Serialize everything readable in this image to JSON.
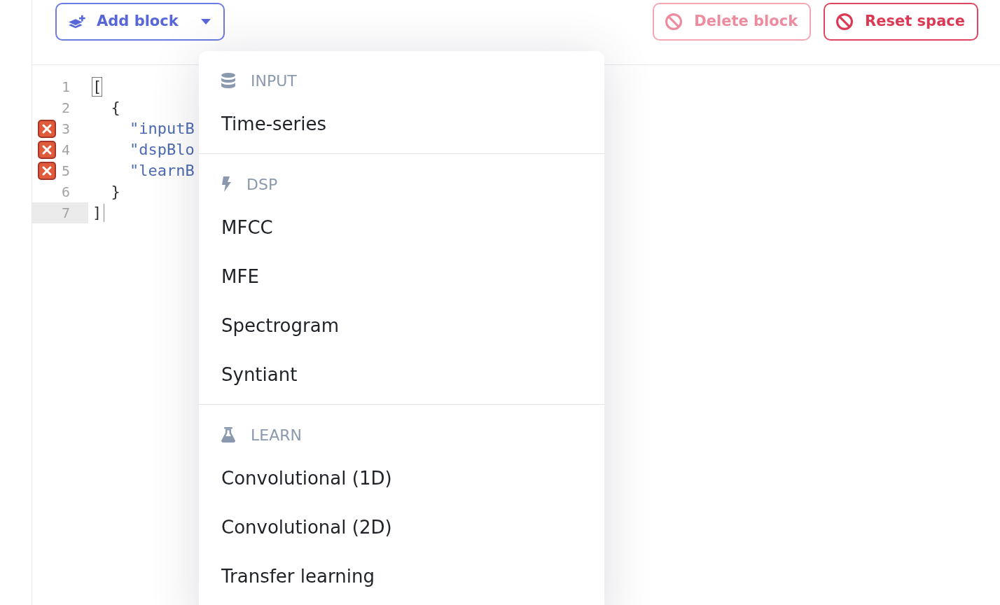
{
  "toolbar": {
    "add_button": {
      "label": "Add block"
    },
    "actions": [
      {
        "label": "Delete block",
        "disabled": true
      },
      {
        "label": "Reset space",
        "disabled": false
      }
    ]
  },
  "editor": {
    "lines": [
      {
        "number": "1",
        "text": "[",
        "kind": "punct",
        "error": false,
        "active": false,
        "bracket_match": true,
        "cursor": false
      },
      {
        "number": "2",
        "text": "  {",
        "kind": "punct",
        "error": false,
        "active": false,
        "bracket_match": false,
        "cursor": false
      },
      {
        "number": "3",
        "text": "    \"inputB",
        "kind": "string",
        "error": true,
        "active": false,
        "bracket_match": false,
        "cursor": false
      },
      {
        "number": "4",
        "text": "    \"dspBlo",
        "kind": "string",
        "error": true,
        "active": false,
        "bracket_match": false,
        "cursor": false
      },
      {
        "number": "5",
        "text": "    \"learnB",
        "kind": "string",
        "error": true,
        "active": false,
        "bracket_match": false,
        "cursor": false
      },
      {
        "number": "6",
        "text": "  }",
        "kind": "punct",
        "error": false,
        "active": false,
        "bracket_match": false,
        "cursor": false
      },
      {
        "number": "7",
        "text": "]",
        "kind": "punct",
        "error": false,
        "active": true,
        "bracket_match": false,
        "cursor": true
      }
    ]
  },
  "menu": {
    "sections": [
      {
        "kind": "input",
        "title": "INPUT",
        "items": [
          "Time-series"
        ]
      },
      {
        "kind": "dsp",
        "title": "DSP",
        "items": [
          "MFCC",
          "MFE",
          "Spectrogram",
          "Syntiant"
        ]
      },
      {
        "kind": "learn",
        "title": "LEARN",
        "items": [
          "Convolutional (1D)",
          "Convolutional (2D)",
          "Transfer learning"
        ]
      }
    ]
  }
}
